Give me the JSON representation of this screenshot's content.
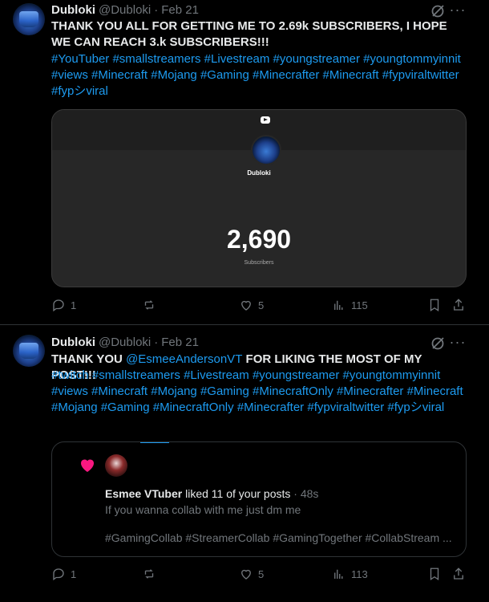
{
  "tweets": [
    {
      "author": "Dubloki",
      "handle": "@Dubloki",
      "separator": "·",
      "date": "Feb 21",
      "text_bold": "THANK YOU ALL FOR GETTING ME TO 2.69k SUBSCRIBERS, I HOPE WE CAN REACH 3.k SUBSCRIBERS!!!",
      "hashtags": [
        "#YouTuber",
        "#smallstreamers",
        "#Livestream",
        "#youngstreamer",
        "#youngtommyinnit",
        "#views",
        "#Minecraft",
        "#Mojang",
        "#Gaming",
        "#Minecrafter",
        "#Minecraft",
        "#fypviraltwitter",
        "#fypシviral"
      ],
      "card": {
        "channel_name": "Dubloki",
        "count": "2,690",
        "label": "Subscribers",
        "icon": "youtube-icon"
      },
      "actions": {
        "replies": "1",
        "reposts": "",
        "likes": "5",
        "views": "115"
      }
    },
    {
      "author": "Dubloki",
      "handle": "@Dubloki",
      "separator": "·",
      "date": "Feb 21",
      "text_bold_prefix": "THANK YOU ",
      "mention": "@EsmeeAndersonVT",
      "text_bold_suffix": "  FOR LIKING THE MOST OF MY POST!!!",
      "hashtags": [
        "#twitch",
        "#smallstreamers",
        "#Livestream",
        "#youngstreamer",
        "#youngtommyinnit",
        "#views",
        "#Minecraft",
        "#Mojang",
        "#Gaming",
        "#MinecraftOnly",
        "#Minecrafter",
        "#Minecraft",
        "#Mojang",
        "#Gaming",
        "#MinecraftOnly",
        "#Minecrafter",
        "#fypviraltwitter",
        "#fypシviral"
      ],
      "quote": {
        "liker_name": "Esmee VTuber",
        "liked_text": "liked 11 of your posts",
        "time": "· 48s",
        "message": "If you wanna collab with me just dm me",
        "tags": "#GamingCollab #StreamerCollab #GamingTogether #CollabStream ..."
      },
      "actions": {
        "replies": "1",
        "reposts": "",
        "likes": "5",
        "views": "113"
      }
    }
  ],
  "colors": {
    "background": "#000000",
    "link": "#1d9bf0",
    "muted": "#71767b",
    "text": "#e7e9ea",
    "heart": "#f91880"
  }
}
